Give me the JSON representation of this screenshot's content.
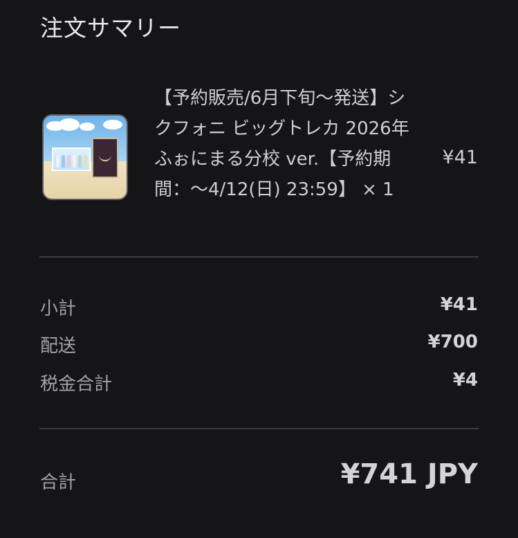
{
  "summary": {
    "title": "注文サマリー"
  },
  "item": {
    "image_alt": "product-thumbnail",
    "name": "【予約販売/6月下旬〜発送】シクフォニ ビッグトレカ 2026年 ふぉにまる分校 ver.【予約期間：〜4/12(日) 23:59】 × 1",
    "price": "¥41"
  },
  "totals": {
    "subtotal_label": "小計",
    "subtotal_value": "¥41",
    "shipping_label": "配送",
    "shipping_value": "¥700",
    "tax_label": "税金合計",
    "tax_value": "¥4",
    "total_label": "合計",
    "total_value": "¥741 JPY"
  }
}
